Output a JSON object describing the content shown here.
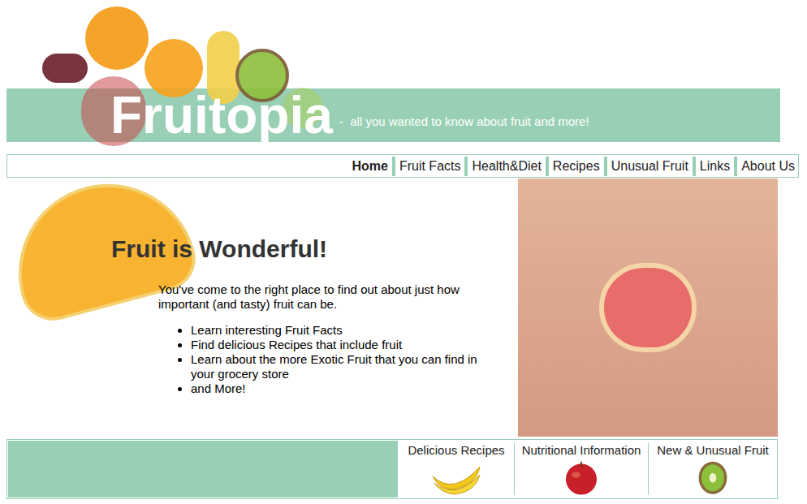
{
  "header": {
    "title": "Fruitopia",
    "tagline": " -  all you wanted to know about fruit and more!"
  },
  "nav": [
    {
      "label": "Home",
      "selected": true
    },
    {
      "label": "Fruit Facts",
      "selected": false
    },
    {
      "label": "Health&Diet",
      "selected": false
    },
    {
      "label": "Recipes",
      "selected": false
    },
    {
      "label": "Unusual Fruit",
      "selected": false
    },
    {
      "label": "Links",
      "selected": false
    },
    {
      "label": "About Us",
      "selected": false
    }
  ],
  "main": {
    "heading": "Fruit is Wonderful!",
    "intro": "You've come to the right place to find out about just how important (and tasty) fruit can be.",
    "list": [
      "Learn interesting Fruit Facts",
      "Find delicious Recipes that include fruit",
      "Learn about the more Exotic Fruit that you can find in your grocery store",
      "and More!"
    ]
  },
  "footer": [
    {
      "label": "Delicious Recipes"
    },
    {
      "label": "Nutritional Information"
    },
    {
      "label": "New & Unusual Fruit"
    }
  ]
}
